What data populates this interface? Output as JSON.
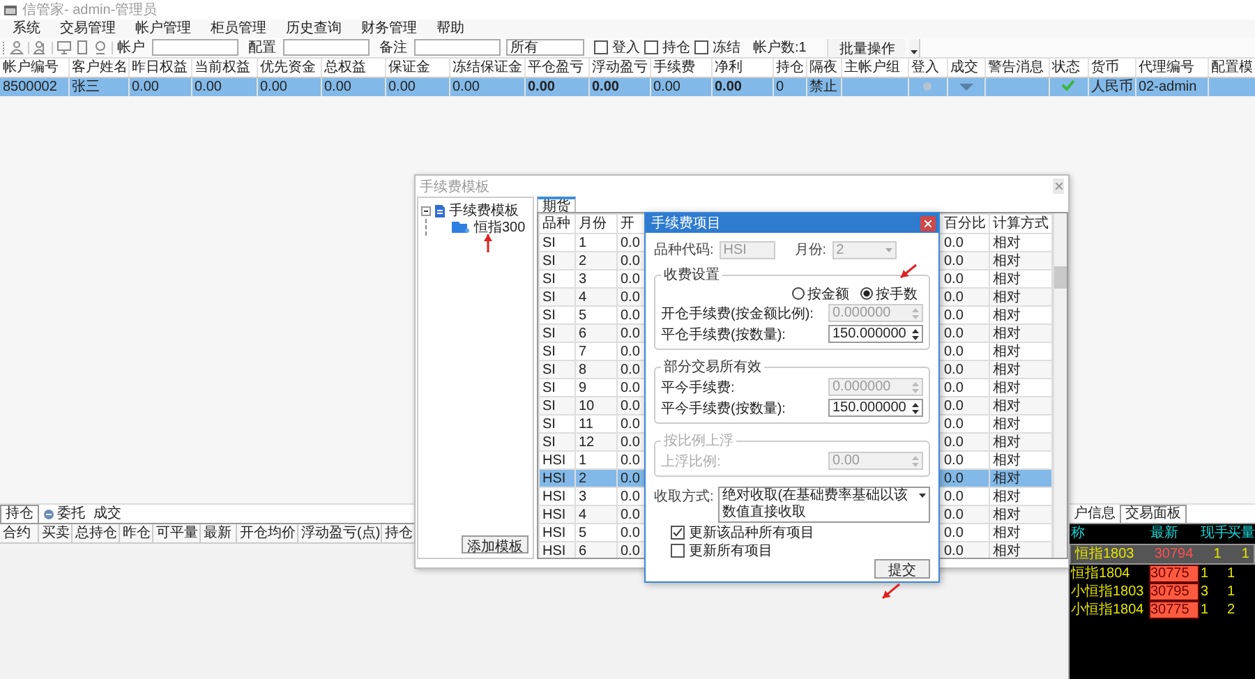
{
  "window": {
    "title": "信管家- admin-管理员"
  },
  "menu": [
    "系统",
    "交易管理",
    "帐户管理",
    "柜员管理",
    "历史查询",
    "财务管理",
    "帮助"
  ],
  "toolbar": {
    "fields": [
      {
        "label": "帐户"
      },
      {
        "label": "配置"
      },
      {
        "label": "备注"
      }
    ],
    "filter_value": "所有",
    "checkboxes": [
      {
        "label": "登入",
        "checked": false
      },
      {
        "label": "持仓",
        "checked": false
      },
      {
        "label": "冻结",
        "checked": false
      }
    ],
    "account_count": "帐户数:1",
    "batch_button": "批量操作"
  },
  "accounts": {
    "columns": [
      "帐户编号",
      "客户姓名",
      "昨日权益",
      "当前权益",
      "优先资金",
      "总权益",
      "保证金",
      "冻结保证金",
      "平仓盈亏",
      "浮动盈亏",
      "手续费",
      "净利",
      "持仓",
      "隔夜",
      "主帐户组",
      "登入",
      "成交",
      "警告消息",
      "状态",
      "货币",
      "代理编号",
      "配置模"
    ],
    "rows": [
      {
        "selected": true,
        "cells": [
          {
            "kind": "text",
            "text": "8500002"
          },
          {
            "kind": "text",
            "text": "张三"
          },
          {
            "kind": "text",
            "text": "0.00"
          },
          {
            "kind": "text",
            "text": "0.00"
          },
          {
            "kind": "text",
            "text": "0.00"
          },
          {
            "kind": "text",
            "text": "0.00"
          },
          {
            "kind": "text",
            "text": "0.00"
          },
          {
            "kind": "text",
            "text": "0.00"
          },
          {
            "kind": "strong",
            "text": "0.00"
          },
          {
            "kind": "strong",
            "text": "0.00"
          },
          {
            "kind": "text",
            "text": "0.00"
          },
          {
            "kind": "strong",
            "text": "0.00"
          },
          {
            "kind": "text",
            "text": "0"
          },
          {
            "kind": "text",
            "text": "禁止"
          },
          {
            "kind": "empty"
          },
          {
            "kind": "login",
            "on": false
          },
          {
            "kind": "trade"
          },
          {
            "kind": "empty"
          },
          {
            "kind": "status",
            "ok": true
          },
          {
            "kind": "text",
            "text": "人民币"
          },
          {
            "kind": "text",
            "text": "02-admin"
          },
          {
            "kind": "empty"
          }
        ]
      }
    ]
  },
  "template_window": {
    "title": "手续费模板",
    "tree": {
      "label": "手续费模板",
      "expanded": true,
      "children": [
        {
          "label": "恒指300"
        }
      ]
    },
    "add_button": "添加模板",
    "tabs": [
      {
        "label": "期货",
        "selected": true
      }
    ],
    "columns": [
      "品种",
      "月份",
      "开",
      "百分比",
      "计算方式"
    ],
    "rows": [
      {
        "product": "SI",
        "month": "1",
        "open": "0.0",
        "percent": "0.0",
        "method": "相对",
        "selected": false
      },
      {
        "product": "SI",
        "month": "2",
        "open": "0.0",
        "percent": "0.0",
        "method": "相对",
        "selected": false
      },
      {
        "product": "SI",
        "month": "3",
        "open": "0.0",
        "percent": "0.0",
        "method": "相对",
        "selected": false
      },
      {
        "product": "SI",
        "month": "4",
        "open": "0.0",
        "percent": "0.0",
        "method": "相对",
        "selected": false
      },
      {
        "product": "SI",
        "month": "5",
        "open": "0.0",
        "percent": "0.0",
        "method": "相对",
        "selected": false
      },
      {
        "product": "SI",
        "month": "6",
        "open": "0.0",
        "percent": "0.0",
        "method": "相对",
        "selected": false
      },
      {
        "product": "SI",
        "month": "7",
        "open": "0.0",
        "percent": "0.0",
        "method": "相对",
        "selected": false
      },
      {
        "product": "SI",
        "month": "8",
        "open": "0.0",
        "percent": "0.0",
        "method": "相对",
        "selected": false
      },
      {
        "product": "SI",
        "month": "9",
        "open": "0.0",
        "percent": "0.0",
        "method": "相对",
        "selected": false
      },
      {
        "product": "SI",
        "month": "10",
        "open": "0.0",
        "percent": "0.0",
        "method": "相对",
        "selected": false
      },
      {
        "product": "SI",
        "month": "11",
        "open": "0.0",
        "percent": "0.0",
        "method": "相对",
        "selected": false
      },
      {
        "product": "SI",
        "month": "12",
        "open": "0.0",
        "percent": "0.0",
        "method": "相对",
        "selected": false
      },
      {
        "product": "HSI",
        "month": "1",
        "open": "0.0",
        "percent": "0.0",
        "method": "相对",
        "selected": false
      },
      {
        "product": "HSI",
        "month": "2",
        "open": "0.0",
        "percent": "0.0",
        "method": "相对",
        "selected": true
      },
      {
        "product": "HSI",
        "month": "3",
        "open": "0.0",
        "percent": "0.0",
        "method": "相对",
        "selected": false
      },
      {
        "product": "HSI",
        "month": "4",
        "open": "0.0",
        "percent": "0.0",
        "method": "相对",
        "selected": false
      },
      {
        "product": "HSI",
        "month": "5",
        "open": "0.0",
        "percent": "0.0",
        "method": "相对",
        "selected": false
      },
      {
        "product": "HSI",
        "month": "6",
        "open": "0.0",
        "percent": "0.0",
        "method": "相对",
        "selected": false
      }
    ]
  },
  "dialog": {
    "title": "手续费项目",
    "product_label": "品种代码:",
    "product_value": "HSI",
    "month_label": "月份:",
    "month_value": "2",
    "groups": [
      {
        "title": "收费设置",
        "disabled": false,
        "radios": [
          {
            "label": "按金额",
            "selected": false
          },
          {
            "label": "按手数",
            "selected": true
          }
        ],
        "fields": [
          {
            "label": "开仓手续费(按金额比例):",
            "value": "0.000000",
            "disabled": true
          },
          {
            "label": "平仓手续费(按数量):",
            "value": "150.000000",
            "disabled": false
          }
        ]
      },
      {
        "title": "部分交易所有效",
        "disabled": false,
        "fields": [
          {
            "label": "平今手续费:",
            "value": "0.000000",
            "disabled": true
          },
          {
            "label": "平今手续费(按数量):",
            "value": "150.000000",
            "disabled": false
          }
        ]
      },
      {
        "title": "按比例上浮",
        "disabled": true,
        "fields": [
          {
            "label": "上浮比例:",
            "value": "0.00",
            "disabled": true
          }
        ]
      }
    ],
    "mode_label": "收取方式:",
    "mode_value": "绝对收取(在基础费率基础以该数值直接收取",
    "checkboxes": [
      {
        "label": "更新该品种所有项目",
        "checked": true
      },
      {
        "label": "更新所有项目",
        "checked": false
      }
    ],
    "submit": "提交"
  },
  "positions_panel": {
    "tabs": [
      {
        "label": "持仓",
        "selected": true,
        "has_icon": false
      },
      {
        "label": "委托",
        "selected": false,
        "has_icon": true
      },
      {
        "label": "成交",
        "selected": false,
        "has_icon": false
      }
    ],
    "columns": [
      "合约",
      "买卖",
      "总持仓",
      "昨仓",
      "可平量",
      "最新",
      "开仓均价",
      "浮动盈亏(点)",
      "持仓"
    ]
  },
  "market_panel": {
    "tabs": [
      {
        "label": "户信息",
        "selected": false
      },
      {
        "label": "交易面板",
        "selected": true
      }
    ],
    "columns": [
      "称",
      "最新",
      "现手",
      "买量"
    ],
    "rows": [
      {
        "name": "恒指1803",
        "last": "30794",
        "volume": "1",
        "bid": "1",
        "selected": true,
        "price_up": false
      },
      {
        "name": "恒指1804",
        "last": "30775",
        "volume": "1",
        "bid": "1",
        "selected": false,
        "price_up": true
      },
      {
        "name": "小恒指1803",
        "last": "30795",
        "volume": "3",
        "bid": "1",
        "selected": false,
        "price_up": true
      },
      {
        "name": "小恒指1804",
        "last": "30775",
        "volume": "1",
        "bid": "2",
        "selected": false,
        "price_up": true
      }
    ]
  }
}
